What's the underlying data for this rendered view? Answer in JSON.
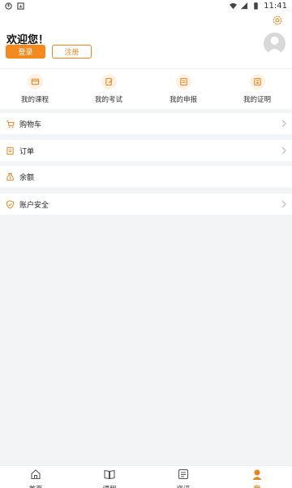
{
  "status_bar": {
    "time": "11:41"
  },
  "header": {
    "greeting": "欢迎您！",
    "login_label": "登录",
    "register_label": "注册"
  },
  "quick_links": [
    {
      "label": "我的课程",
      "icon": "course-icon"
    },
    {
      "label": "我的考试",
      "icon": "exam-icon"
    },
    {
      "label": "我的申报",
      "icon": "declaration-icon"
    },
    {
      "label": "我的证明",
      "icon": "certificate-icon"
    }
  ],
  "menu": [
    {
      "label": "购物车",
      "icon": "cart-icon",
      "arrow": true
    },
    {
      "label": "订单",
      "icon": "order-icon",
      "arrow": true
    },
    {
      "label": "余额",
      "icon": "balance-icon",
      "arrow": false
    },
    {
      "label": "账户安全",
      "icon": "shield-icon",
      "arrow": true
    }
  ],
  "tabbar": [
    {
      "label": "首页",
      "icon": "home-icon"
    },
    {
      "label": "课程",
      "icon": "book-icon"
    },
    {
      "label": "资讯",
      "icon": "news-icon"
    },
    {
      "label": "我",
      "icon": "user-icon",
      "active": true
    }
  ],
  "colors": {
    "accent": "#f28a1e",
    "background": "#f3f4f6",
    "card": "#ffffff"
  }
}
